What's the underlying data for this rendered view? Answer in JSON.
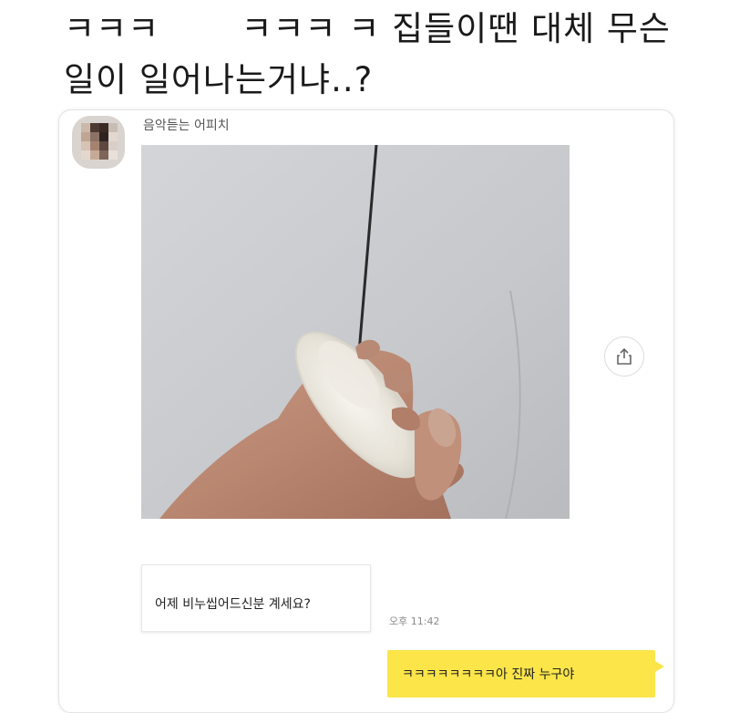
{
  "caption": {
    "line1": "ㅋㅋㅋ       ㅋㅋㅋ ㅋ 집들이땐 대체 무슨",
    "line2": "일이 일어나는거냐..?"
  },
  "chat": {
    "sender_name": "음악듣는 어피치",
    "incoming_message": "어제 비누씹어드신분 계세요?",
    "incoming_time": "오후 11:42",
    "outgoing_message": "ㅋㅋㅋㅋㅋㅋㅋㅋ아 진짜 누구야"
  },
  "icons": {
    "share": "share-icon",
    "avatar": "avatar-image"
  },
  "colors": {
    "outgoing_bubble": "#fbe548",
    "card_border": "#e4e4e4",
    "timestamp": "#8a8a8a"
  }
}
